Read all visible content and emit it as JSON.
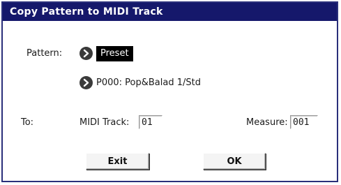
{
  "dialog": {
    "title": "Copy Pattern to MIDI Track"
  },
  "pattern": {
    "label": "Pattern:",
    "type_value": "Preset",
    "pattern_value": "P000: Pop&Balad 1/Std"
  },
  "destination": {
    "to_label": "To:",
    "midi_track_label": "MIDI Track:",
    "midi_track_value": "01",
    "measure_label": "Measure:",
    "measure_value": "001"
  },
  "buttons": {
    "exit_label": "Exit",
    "ok_label": "OK"
  },
  "icons": {
    "pattern_type_arrow": "chevron-right-icon",
    "pattern_select_arrow": "chevron-right-icon"
  },
  "colors": {
    "titlebar_bg": "#15186b",
    "selected_bg": "#000000"
  }
}
